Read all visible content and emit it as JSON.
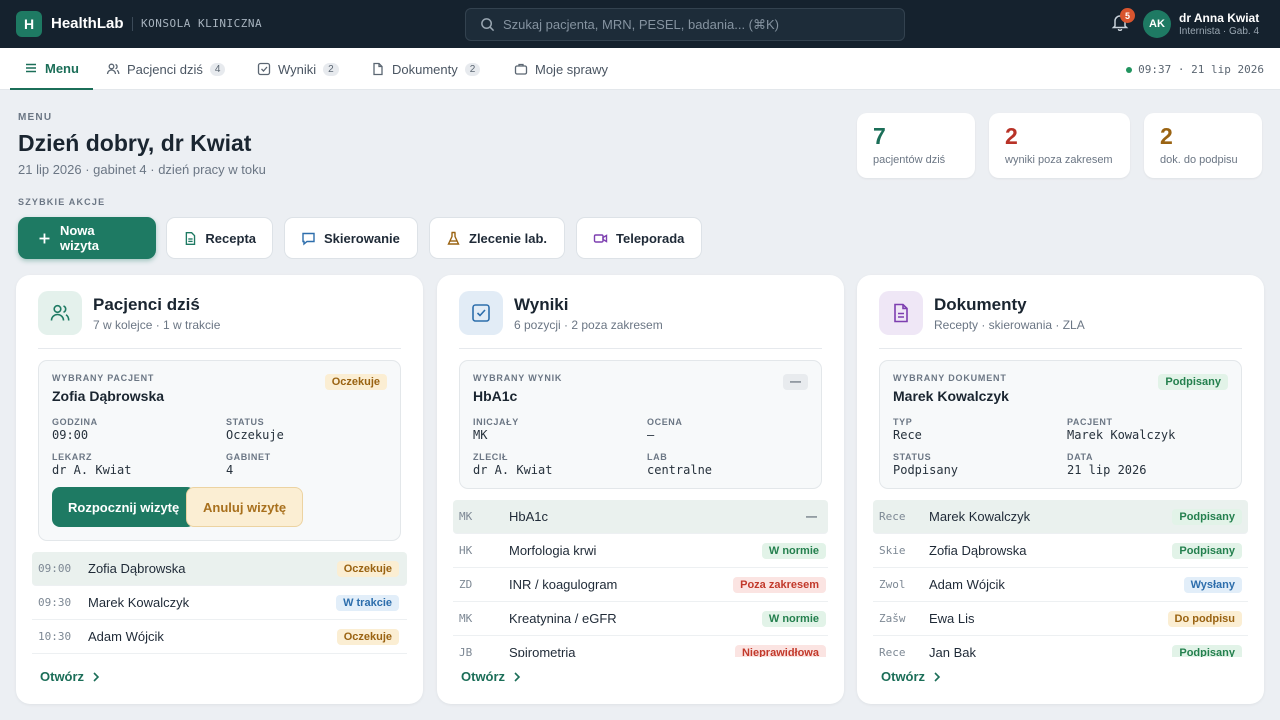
{
  "topbar": {
    "logo_letter": "H",
    "brand": "HealthLab",
    "subtitle": "KONSOLA KLINICZNA",
    "search_placeholder": "Szukaj pacjenta, MRN, PESEL, badania... (⌘K)",
    "notifications_count": "5",
    "user_initials": "AK",
    "user_name": "dr Anna Kwiat",
    "user_role": "Internista · Gab. 4"
  },
  "nav": {
    "tabs": [
      {
        "label": "Menu",
        "count": ""
      },
      {
        "label": "Pacjenci dziś",
        "count": "4"
      },
      {
        "label": "Wyniki",
        "count": "2"
      },
      {
        "label": "Dokumenty",
        "count": "2"
      },
      {
        "label": "Moje sprawy",
        "count": ""
      }
    ],
    "clock": "09:37 · 21 lip 2026"
  },
  "header": {
    "eyebrow": "MENU",
    "greeting": "Dzień dobry, dr Kwiat",
    "subtitle": "21 lip 2026 · gabinet 4 · dzień pracy w toku"
  },
  "stats": [
    {
      "value": "7",
      "label": "pacjentów dziś",
      "color": "#1b6e58"
    },
    {
      "value": "2",
      "label": "wyniki poza zakresem",
      "color": "#b83227"
    },
    {
      "value": "2",
      "label": "dok. do podpisu",
      "color": "#9a6312"
    }
  ],
  "quick_actions": {
    "eyebrow": "SZYBKIE AKCJE",
    "items": [
      "Nowa wizyta",
      "Recepta",
      "Skierowanie",
      "Zlecenie lab.",
      "Teleporada"
    ]
  },
  "patients_card": {
    "title": "Pacjenci dziś",
    "subtitle": "7 w kolejce · 1 w trakcie",
    "selected": {
      "eyebrow": "WYBRANY PACJENT",
      "name": "Zofia Dąbrowska",
      "badge": "Oczekuje",
      "fields": [
        {
          "label": "GODZINA",
          "value": "09:00"
        },
        {
          "label": "STATUS",
          "value": "Oczekuje"
        },
        {
          "label": "LEKARZ",
          "value": "dr A. Kwiat"
        },
        {
          "label": "GABINET",
          "value": "4"
        }
      ],
      "start_button": "Rozpocznij wizytę",
      "cancel_button": "Anuluj wizytę"
    },
    "rows": [
      {
        "key": "09:00",
        "text": "Zofia Dąbrowska",
        "badge": "Oczekuje",
        "type": "b-wait"
      },
      {
        "key": "09:30",
        "text": "Marek Kowalczyk",
        "badge": "W trakcie",
        "type": "b-prog"
      },
      {
        "key": "10:30",
        "text": "Adam Wójcik",
        "badge": "Oczekuje",
        "type": "b-wait"
      }
    ],
    "open_link": "Otwórz"
  },
  "results_card": {
    "title": "Wyniki",
    "subtitle": "6 pozycji · 2 poza zakresem",
    "selected": {
      "eyebrow": "WYBRANY WYNIK",
      "name": "HbA1c",
      "badge": "—",
      "fields": [
        {
          "label": "INICJAŁY",
          "value": "MK"
        },
        {
          "label": "OCENA",
          "value": "—"
        },
        {
          "label": "ZLECIŁ",
          "value": "dr A. Kwiat"
        },
        {
          "label": "LAB",
          "value": "centralne"
        }
      ]
    },
    "rows": [
      {
        "key": "MK",
        "text": "HbA1c",
        "badge": "—",
        "type": "b-neu"
      },
      {
        "key": "HK",
        "text": "Morfologia krwi",
        "badge": "W normie",
        "type": "b-ok"
      },
      {
        "key": "ZD",
        "text": "INR / koagulogram",
        "badge": "Poza zakresem",
        "type": "b-bad"
      },
      {
        "key": "MK",
        "text": "Kreatynina / eGFR",
        "badge": "W normie",
        "type": "b-ok"
      },
      {
        "key": "JB",
        "text": "Spirometria",
        "badge": "Nieprawidłowa",
        "type": "b-bad"
      }
    ],
    "open_link": "Otwórz"
  },
  "documents_card": {
    "title": "Dokumenty",
    "subtitle": "Recepty · skierowania · ZLA",
    "selected": {
      "eyebrow": "WYBRANY DOKUMENT",
      "name": "Marek Kowalczyk",
      "badge": "Podpisany",
      "fields": [
        {
          "label": "TYP",
          "value": "Rece"
        },
        {
          "label": "PACJENT",
          "value": "Marek Kowalczyk"
        },
        {
          "label": "STATUS",
          "value": "Podpisany"
        },
        {
          "label": "DATA",
          "value": "21 lip 2026"
        }
      ]
    },
    "rows": [
      {
        "key": "Rece",
        "text": "Marek Kowalczyk",
        "badge": "Podpisany",
        "type": "b-ok"
      },
      {
        "key": "Skie",
        "text": "Zofia Dąbrowska",
        "badge": "Podpisany",
        "type": "b-ok"
      },
      {
        "key": "Zwol",
        "text": "Adam Wójcik",
        "badge": "Wysłany",
        "type": "b-sent"
      },
      {
        "key": "Zašw",
        "text": "Ewa Lis",
        "badge": "Do podpisu",
        "type": "b-wait"
      },
      {
        "key": "Rece",
        "text": "Jan Bąk",
        "badge": "Podpisany",
        "type": "b-ok"
      }
    ],
    "open_link": "Otwórz"
  }
}
